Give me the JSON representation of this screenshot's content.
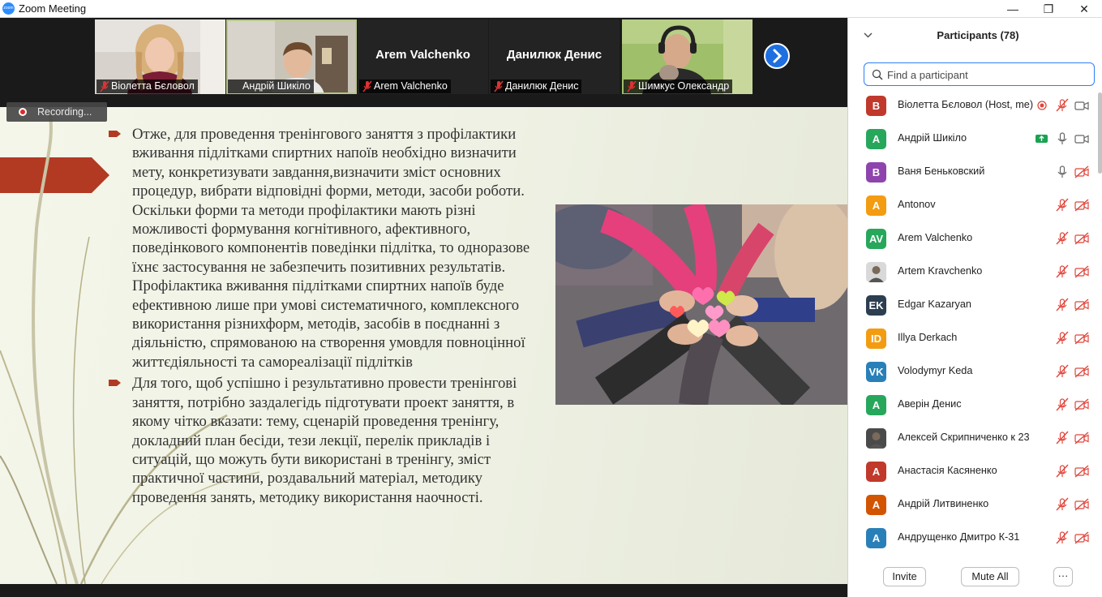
{
  "window": {
    "title": "Zoom Meeting",
    "app_icon_text": "zoom",
    "minimize_glyph": "—",
    "restore_glyph": "❐",
    "close_glyph": "✕"
  },
  "video_strip": {
    "tiles": [
      {
        "name": "Віолетта Бєловол",
        "muted": true,
        "has_video": true
      },
      {
        "name": "Андрій Шикіло",
        "muted": true,
        "has_video": true,
        "active_speaker": true
      },
      {
        "name": "Arem Valchenko",
        "display": "Arem Valchenko",
        "muted": true,
        "has_video": false
      },
      {
        "name": "Данилюк Денис",
        "display": "Данилюк Денис",
        "muted": true,
        "has_video": false
      },
      {
        "name": "Шимкус Олександр",
        "muted": true,
        "has_video": true
      }
    ],
    "next_icon": "chevron-right-icon"
  },
  "recording": {
    "label": "Recording..."
  },
  "slide": {
    "bullets": [
      "Отже, для проведення тренінгового заняття з профілактики вживання підлітками спиртних напоїв необхідно визначити мету, конкретизувати завдання,визначити зміст основних процедур, вибрати відповідні форми, методи, засоби роботи. Оскільки форми та методи профілактики мають різні можливості формування когнітивного, афективного, поведінкового компонентів поведінки підлітка, то одноразове їхнє застосування не  забезпечить  позитивних результатів. Профілактика вживання підлітками спиртних напоїв буде ефективною лише при умові систематичного, комплексного використання різнихформ, методів, засобів в поєднанні з діяльністю, спрямованою на створення умовдля повноцінної життєдіяльності та самореалізації підлітків",
      "Для того, щоб успішно і результативно провести тренінгові заняття, потрібно заздалегідь підготувати проект заняття, в якому чітко вказати: тему, сценарій проведення тренінгу, докладний план бесіди, тези лекції, перелік прикладів і ситуацій, що можуть бути використані в тренінгу, зміст практичної частини, роздавальний матеріал, методику проведення занять, методику використання наочності."
    ],
    "accent_color": "#b23a22"
  },
  "participants_panel": {
    "title": "Participants (78)",
    "search_placeholder": "Find a participant",
    "participants": [
      {
        "initials": "В",
        "color": "#c0392b",
        "name": "Віолетта Бєловол (Host, me)",
        "recording": true,
        "mic": "muted",
        "video": "on"
      },
      {
        "initials": "А",
        "color": "#27a75c",
        "name": "Андрій Шикіло",
        "sharing": true,
        "mic": "on",
        "video": "on"
      },
      {
        "initials": "В",
        "color": "#8e44ad",
        "name": "Ваня Беньковский",
        "mic": "on",
        "video": "off"
      },
      {
        "initials": "A",
        "color": "#f39c12",
        "name": "Antonov",
        "mic": "muted",
        "video": "off"
      },
      {
        "initials": "AV",
        "color": "#27a75c",
        "name": "Arem Valchenko",
        "mic": "muted",
        "video": "off"
      },
      {
        "initials": "",
        "color": "#d9d9d9",
        "name": "Artem Kravchenko",
        "photo": true,
        "mic": "muted",
        "video": "off"
      },
      {
        "initials": "EK",
        "color": "#2c3e50",
        "name": "Edgar Kazaryan",
        "mic": "muted",
        "video": "off"
      },
      {
        "initials": "ID",
        "color": "#f39c12",
        "name": "Illya Derkach",
        "mic": "muted",
        "video": "off"
      },
      {
        "initials": "VK",
        "color": "#2980b9",
        "name": "Volodymyr Keda",
        "mic": "muted",
        "video": "off"
      },
      {
        "initials": "А",
        "color": "#27a75c",
        "name": "Аверін Денис",
        "mic": "muted",
        "video": "off"
      },
      {
        "initials": "",
        "color": "#4a4a4a",
        "name": "Алексей Скрипниченко к 23",
        "photo": true,
        "mic": "muted",
        "video": "off"
      },
      {
        "initials": "А",
        "color": "#c0392b",
        "name": "Анастасія Касяненко",
        "mic": "muted",
        "video": "off"
      },
      {
        "initials": "А",
        "color": "#d35400",
        "name": "Андрій Литвиненко",
        "mic": "muted",
        "video": "off"
      },
      {
        "initials": "А",
        "color": "#2980b9",
        "name": "Андрущенко Дмитро К-31",
        "mic": "muted",
        "video": "off"
      }
    ],
    "footer": {
      "invite": "Invite",
      "mute_all": "Mute All",
      "more": "···"
    }
  }
}
